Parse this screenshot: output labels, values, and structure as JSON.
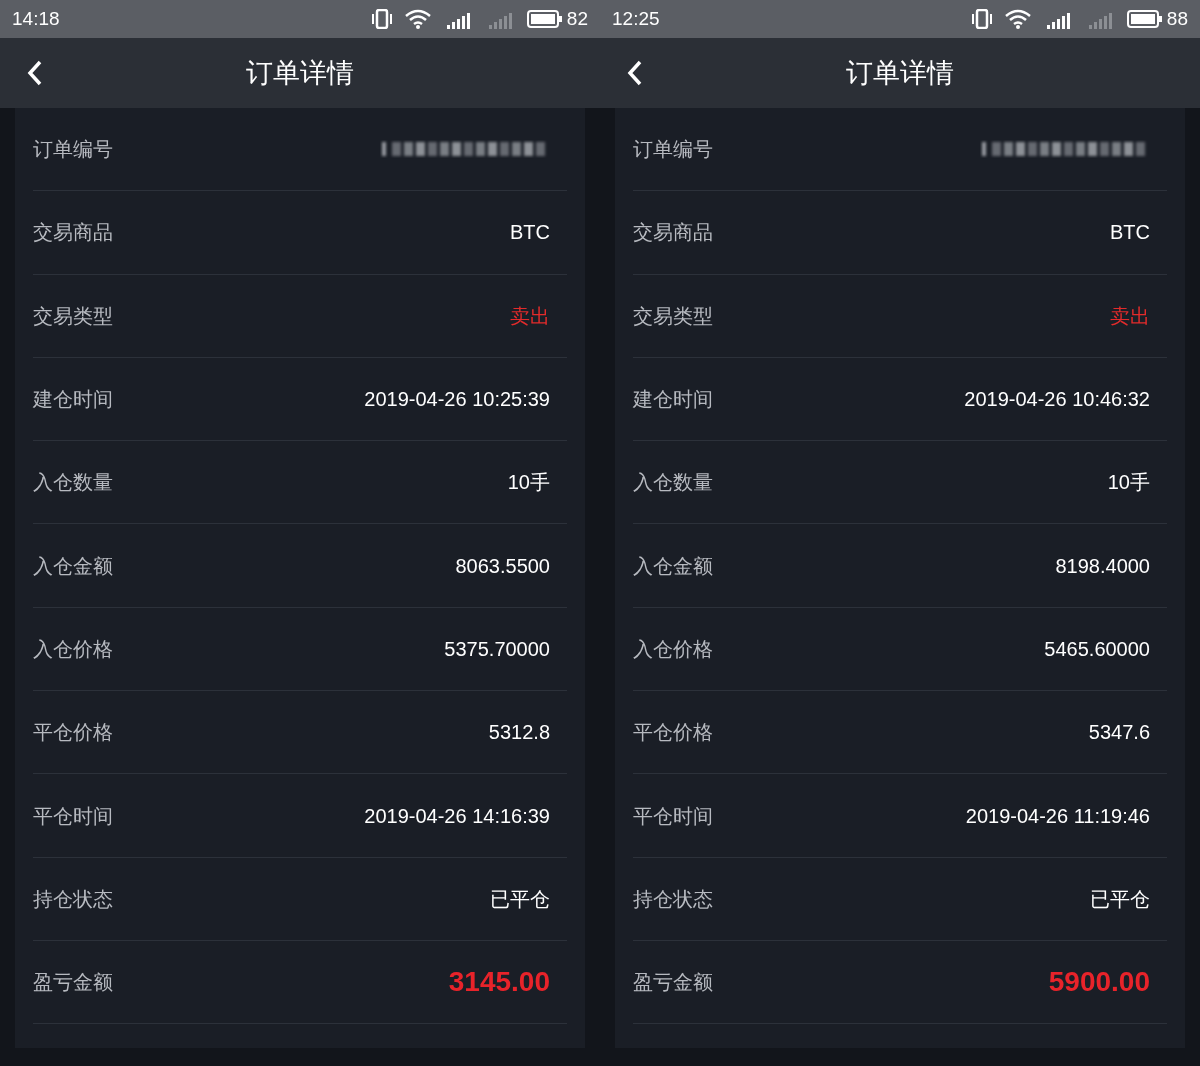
{
  "phones": [
    {
      "status_bar": {
        "time": "14:18",
        "battery": "82"
      },
      "header": {
        "title": "订单详情"
      },
      "rows": [
        {
          "label": "订单编号",
          "kind": "blurred"
        },
        {
          "label": "交易商品",
          "value": "BTC",
          "kind": "text"
        },
        {
          "label": "交易类型",
          "value": "卖出",
          "kind": "red"
        },
        {
          "label": "建仓时间",
          "value": "2019-04-26 10:25:39",
          "kind": "text"
        },
        {
          "label": "入仓数量",
          "value": "10手",
          "kind": "text"
        },
        {
          "label": "入仓金额",
          "value": "8063.5500",
          "kind": "text"
        },
        {
          "label": "入仓价格",
          "value": "5375.70000",
          "kind": "text"
        },
        {
          "label": "平仓价格",
          "value": "5312.8",
          "kind": "text"
        },
        {
          "label": "平仓时间",
          "value": "2019-04-26 14:16:39",
          "kind": "text"
        },
        {
          "label": "持仓状态",
          "value": "已平仓",
          "kind": "text"
        },
        {
          "label": "盈亏金额",
          "value": "3145.00",
          "kind": "profit"
        }
      ]
    },
    {
      "status_bar": {
        "time": "12:25",
        "battery": "88"
      },
      "header": {
        "title": "订单详情"
      },
      "rows": [
        {
          "label": "订单编号",
          "kind": "blurred"
        },
        {
          "label": "交易商品",
          "value": "BTC",
          "kind": "text"
        },
        {
          "label": "交易类型",
          "value": "卖出",
          "kind": "red"
        },
        {
          "label": "建仓时间",
          "value": "2019-04-26 10:46:32",
          "kind": "text"
        },
        {
          "label": "入仓数量",
          "value": "10手",
          "kind": "text"
        },
        {
          "label": "入仓金额",
          "value": "8198.4000",
          "kind": "text"
        },
        {
          "label": "入仓价格",
          "value": "5465.60000",
          "kind": "text"
        },
        {
          "label": "平仓价格",
          "value": "5347.6",
          "kind": "text"
        },
        {
          "label": "平仓时间",
          "value": "2019-04-26 11:19:46",
          "kind": "text"
        },
        {
          "label": "持仓状态",
          "value": "已平仓",
          "kind": "text"
        },
        {
          "label": "盈亏金额",
          "value": "5900.00",
          "kind": "profit"
        }
      ]
    }
  ]
}
